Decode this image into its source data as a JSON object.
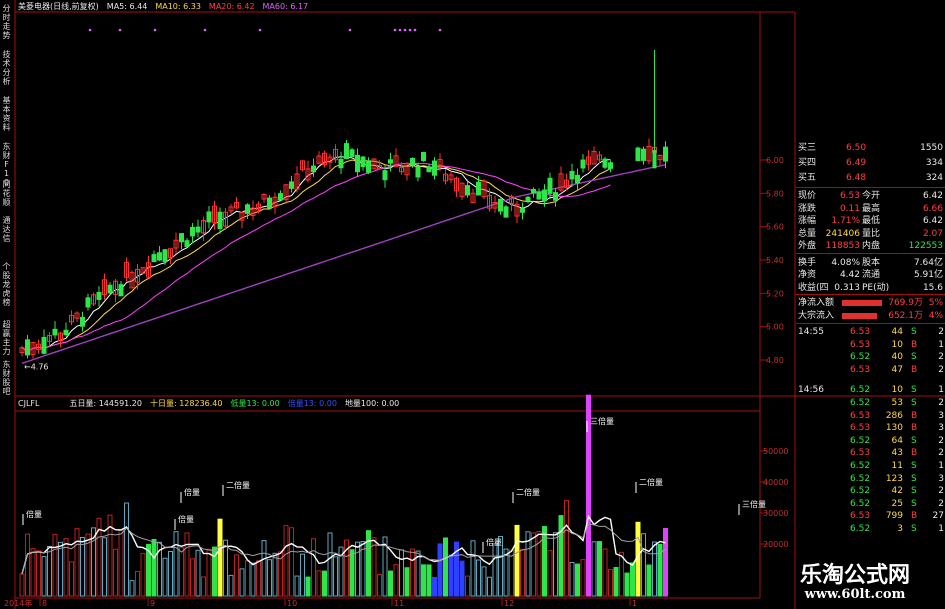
{
  "side_tabs": [
    "分时走势",
    "技术分析",
    "基本资料",
    "东财F10",
    "同花顺",
    "通达信",
    "个股龙虎榜",
    "超赢主力",
    "东财股吧"
  ],
  "price_header": {
    "stock": "美菱电器(日线,前复权)",
    "ma5": "MA5: 6.44",
    "ma10": "MA10: 6.33",
    "ma20": "MA20: 6.42",
    "ma60": "MA60: 6.17"
  },
  "vol_header": {
    "name": "CJLFL",
    "five_day": "五日量: 144591.20",
    "ten_day": "十日量: 128236.40",
    "low_vol": "低量13: 0.00",
    "mid_vol": "倍量13: 0.00",
    "ground_vol": "地量100: 0.00"
  },
  "price_axis": [
    "6.00",
    "5.80",
    "5.60",
    "5.40",
    "5.20",
    "5.00",
    "4.80"
  ],
  "volume_axis": [
    "50000",
    "40000",
    "30000",
    "20000"
  ],
  "min_price_label": "4.76",
  "date_axis": [
    {
      "label": "2014年",
      "pos": 0
    },
    {
      "label": "8",
      "pos": 1
    },
    {
      "label": "9",
      "pos": 2
    },
    {
      "label": "10",
      "pos": 3
    },
    {
      "label": "11",
      "pos": 4
    },
    {
      "label": "12",
      "pos": 5
    },
    {
      "label": "1",
      "pos": 6
    }
  ],
  "volume_annotations": [
    {
      "text": "倍量",
      "idx": 0
    },
    {
      "text": "倍量",
      "idx": 1
    },
    {
      "text": "倍量",
      "idx": 2
    },
    {
      "text": "二倍量",
      "idx": 3
    },
    {
      "text": "倍量",
      "idx": 4
    },
    {
      "text": "二倍量",
      "idx": 5
    },
    {
      "text": "三倍量",
      "idx": 6
    },
    {
      "text": "二倍量",
      "idx": 7
    },
    {
      "text": "三倍量",
      "idx": 8
    }
  ],
  "quote": {
    "bids": [
      {
        "label": "买三",
        "price": "6.50",
        "vol": "1550"
      },
      {
        "label": "买四",
        "price": "6.49",
        "vol": "334"
      },
      {
        "label": "买五",
        "price": "6.48",
        "vol": "324"
      }
    ],
    "stats": [
      {
        "l1": "现价",
        "v1": "6.53",
        "l2": "今开",
        "v2": "6.42",
        "c1": "red",
        "c2": "wht"
      },
      {
        "l1": "涨跌",
        "v1": "0.11",
        "l2": "最高",
        "v2": "6.66",
        "c1": "red",
        "c2": "red"
      },
      {
        "l1": "涨幅",
        "v1": "1.71%",
        "l2": "最低",
        "v2": "6.42",
        "c1": "red",
        "c2": "wht"
      },
      {
        "l1": "总量",
        "v1": "241406",
        "l2": "量比",
        "v2": "2.07",
        "c1": "yel",
        "c2": "red"
      },
      {
        "l1": "外盘",
        "v1": "118853",
        "l2": "内盘",
        "v2": "122553",
        "c1": "red",
        "c2": "grn"
      },
      {
        "l1": "换手",
        "v1": "4.08%",
        "l2": "股本",
        "v2": "7.64亿",
        "c1": "wht",
        "c2": "wht"
      },
      {
        "l1": "净资",
        "v1": "4.42",
        "l2": "流通",
        "v2": "5.91亿",
        "c1": "wht",
        "c2": "wht"
      },
      {
        "l1": "收益(四",
        "v1": "0.313",
        "l2": "PE(动)",
        "v2": "15.6",
        "c1": "wht",
        "c2": "wht"
      }
    ],
    "flows": [
      {
        "label": "净流入额",
        "value": "769.9万",
        "pct": "5%",
        "bar": 0.8
      },
      {
        "label": "大宗流入",
        "value": "652.1万",
        "pct": "4%",
        "bar": 0.7
      }
    ]
  },
  "ticks": [
    {
      "time": "14:55",
      "price": "6.53",
      "vol": "44",
      "side": "S",
      "n": "2"
    },
    {
      "time": "",
      "price": "6.53",
      "vol": "10",
      "side": "B",
      "n": "1"
    },
    {
      "time": "",
      "price": "6.52",
      "vol": "40",
      "side": "S",
      "n": "2"
    },
    {
      "time": "",
      "price": "6.53",
      "vol": "47",
      "side": "B",
      "n": "2"
    },
    {
      "time": "14:56",
      "price": "6.52",
      "vol": "10",
      "side": "S",
      "n": "1"
    },
    {
      "time": "",
      "price": "6.52",
      "vol": "53",
      "side": "S",
      "n": "2"
    },
    {
      "time": "",
      "price": "6.53",
      "vol": "286",
      "side": "B",
      "n": "3"
    },
    {
      "time": "",
      "price": "6.53",
      "vol": "130",
      "side": "B",
      "n": "3"
    },
    {
      "time": "",
      "price": "6.52",
      "vol": "64",
      "side": "S",
      "n": "2"
    },
    {
      "time": "",
      "price": "6.53",
      "vol": "43",
      "side": "B",
      "n": "2"
    },
    {
      "time": "",
      "price": "6.52",
      "vol": "11",
      "side": "S",
      "n": "1"
    },
    {
      "time": "",
      "price": "6.52",
      "vol": "123",
      "side": "S",
      "n": "3"
    },
    {
      "time": "",
      "price": "6.52",
      "vol": "42",
      "side": "S",
      "n": "2"
    },
    {
      "time": "",
      "price": "6.52",
      "vol": "25",
      "side": "S",
      "n": "2"
    },
    {
      "time": "",
      "price": "6.53",
      "vol": "799",
      "side": "B",
      "n": "27"
    },
    {
      "time": "",
      "price": "6.52",
      "vol": "3",
      "side": "S",
      "n": "1"
    }
  ],
  "watermark": {
    "cn": "乐淘公式网",
    "url": "www.60lt.com"
  },
  "colors": {
    "up": "#ff3030",
    "down": "#2ee64a",
    "ma5": "#ffffff",
    "ma10": "#ffd84a",
    "ma20": "#ff40ff",
    "ma60": "#a040c0",
    "vol_big": "#ffff40",
    "vol_triple": "#e040ff",
    "bg": "#000000",
    "frame": "#a01010"
  }
}
